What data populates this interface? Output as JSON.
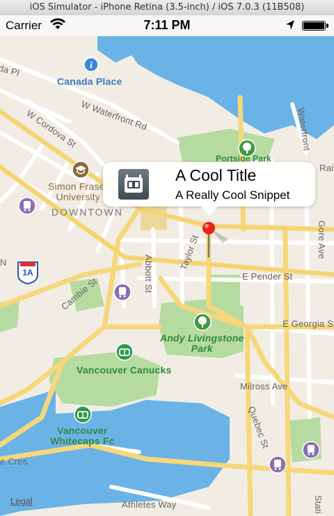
{
  "simulator": {
    "title": "iOS Simulator - iPhone Retina (3.5-inch) / iOS 7.0.3 (11B508)"
  },
  "status_bar": {
    "carrier": "Carrier",
    "time": "7:11 PM"
  },
  "callout": {
    "title": "A Cool Title",
    "subtitle": "A Really Cool Snippet",
    "icon": "app-robot-icon"
  },
  "map": {
    "pois": {
      "canada_place": "Canada Place",
      "simon_fraser_1": "Simon Fraser",
      "simon_fraser_2": "University",
      "andy_livingstone": "Andy Livingstone",
      "andy_park": "Park",
      "vancouver_canucks": "Vancouver Canucks",
      "whitecaps_1": "Vancouver",
      "whitecaps_2": "Whitecaps Fc"
    },
    "district": "DOWNTOWN",
    "highway_shield": "1A",
    "streets": {
      "cordova": "W Cordova St",
      "waterfront": "W Waterfront Rd",
      "pender": "E Pender St",
      "georgia": "E Georgia St",
      "abbott": "Abbott St",
      "taylor": "Taylor St",
      "cambie": "Cambie St",
      "milross": "Milross Ave",
      "quebec": "Quebec St",
      "athletes": "Athletes Way",
      "gore": "Gore Ave",
      "waterfront_r": "Waterfront",
      "crescent": "e Cres",
      "frag_topleft": "da Pl",
      "frag_n": "N",
      "frag_rai": "Rai",
      "frag_station": "Stati",
      "frag_park": "Portside Park"
    },
    "legal": "Legal"
  },
  "colors": {
    "water": "#6bb3e6",
    "land": "#f1ede4",
    "park": "#b6dba0",
    "road_major": "#f6d77a",
    "road_minor": "#ffffff",
    "pin": "#e8231c"
  }
}
